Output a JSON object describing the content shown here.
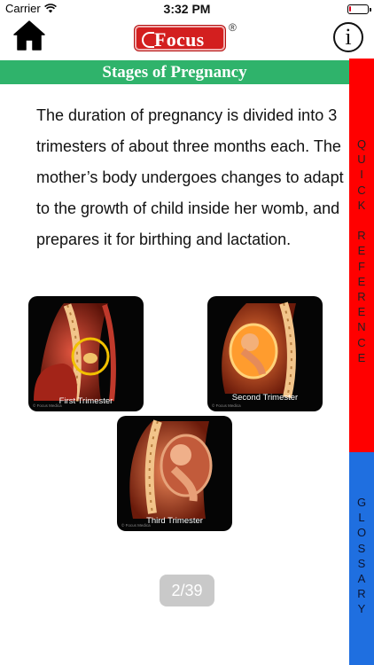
{
  "status_bar": {
    "carrier": "Carrier",
    "time": "3:32 PM",
    "battery_level": 0.12
  },
  "nav": {
    "home_icon": "home-icon",
    "logo_text": "Focus",
    "logo_registered": "®",
    "info_glyph": "i",
    "info_icon": "info-icon"
  },
  "page": {
    "title": "Stages of Pregnancy",
    "body": "The duration of pregnancy is divided into 3 trimesters of about three months each. The mother’s body undergoes changes to adapt to the growth of child inside her womb, and prepares it for birthing and lactation."
  },
  "illustrations": [
    {
      "caption": "First Trimester",
      "credit": "© Focus Medica"
    },
    {
      "caption": "Second Trimester",
      "credit": "© Focus Medica"
    },
    {
      "caption": "Third Trimester",
      "credit": "© Focus Medica"
    }
  ],
  "side_tabs": {
    "quick_reference": "QUICK REFERENCE",
    "glossary": "GLOSSARY"
  },
  "pagination": {
    "label": "2/39"
  },
  "colors": {
    "title_bar": "#2fb36b",
    "quick_reference_tab": "#ff0000",
    "glossary_tab": "#1f6fe0",
    "logo_red": "#d31f1f"
  }
}
